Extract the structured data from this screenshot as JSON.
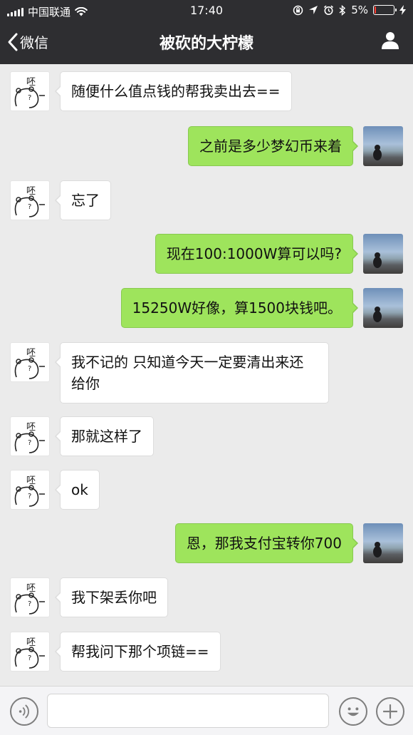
{
  "status_bar": {
    "carrier": "中国联通",
    "time": "17:40",
    "battery": "5%",
    "signal_icon": "signal-icon",
    "wifi_icon": "wifi-icon",
    "battery_level": 0.05
  },
  "nav": {
    "back_label": "微信",
    "title": "被砍的大柠檬",
    "profile_icon": "person-icon"
  },
  "messages": [
    {
      "side": "left",
      "text": "随便什么值点钱的帮我卖出去=="
    },
    {
      "side": "right",
      "text": "之前是多少梦幻币来着"
    },
    {
      "side": "left",
      "text": "忘了"
    },
    {
      "side": "right",
      "text": "现在100:1000W算可以吗?"
    },
    {
      "side": "right",
      "text": "15250W好像，算1500块钱吧。"
    },
    {
      "side": "left",
      "text": "我不记的 只知道今天一定要清出来还给你"
    },
    {
      "side": "left",
      "text": "那就这样了"
    },
    {
      "side": "left",
      "text": "ok"
    },
    {
      "side": "right",
      "text": "恩，那我支付宝转你700"
    },
    {
      "side": "left",
      "text": "我下架丢你吧"
    },
    {
      "side": "left",
      "text": "帮我问下那个项链=="
    }
  ],
  "friend_avatar_text": "呸",
  "input_bar": {
    "text_value": "",
    "voice_icon": "voice-icon",
    "emoji_icon": "emoji-icon",
    "plus_icon": "plus-icon"
  },
  "colors": {
    "bar_bg": "#2e2e31",
    "chat_bg": "#ebebeb",
    "bubble_mine": "#9ee45c",
    "bubble_theirs": "#ffffff"
  }
}
